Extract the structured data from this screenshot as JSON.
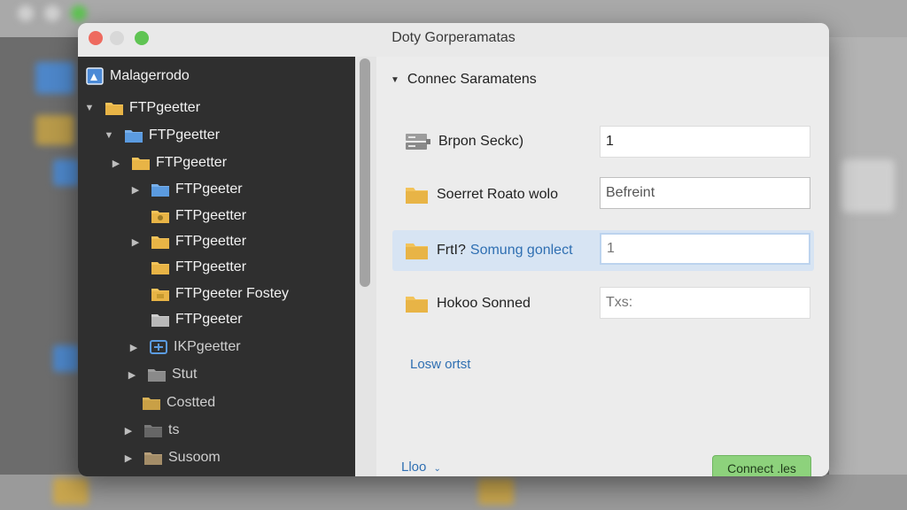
{
  "window": {
    "title": "Doty Gorperamatas"
  },
  "sidebar": {
    "root_label": "Malagerrodo",
    "items": [
      {
        "label": "FTPgeetter",
        "disclosure": "open",
        "icon": "folder-yellow"
      },
      {
        "label": "FTPgeetter",
        "disclosure": "open",
        "icon": "folder-blue"
      },
      {
        "label": "FTPgeetter",
        "disclosure": "closed",
        "icon": "folder-yellow"
      },
      {
        "label": "FTPgeeter",
        "disclosure": "closed",
        "icon": "folder-blue"
      },
      {
        "label": "FTPgeetter",
        "disclosure": "none",
        "icon": "folder-yellow"
      },
      {
        "label": "FTPgeetter",
        "disclosure": "closed",
        "icon": "folder-yellow"
      },
      {
        "label": "FTPgeetter",
        "disclosure": "none",
        "icon": "folder-yellow"
      },
      {
        "label": "FTPgeeter Fostey",
        "disclosure": "none",
        "icon": "folder-yellow"
      },
      {
        "label": "FTPgeeter",
        "disclosure": "none",
        "icon": "folder-gray"
      },
      {
        "label": "IKPgeetter",
        "disclosure": "closed",
        "icon": "network-folder-icon"
      },
      {
        "label": "Stut",
        "disclosure": "closed",
        "icon": "folder-gray"
      },
      {
        "label": "Costted",
        "disclosure": "none",
        "icon": "folder-yellow"
      },
      {
        "label": "ts",
        "disclosure": "closed",
        "icon": "folder-gray"
      },
      {
        "label": "Susoom",
        "disclosure": "closed",
        "icon": "folder-tan"
      }
    ]
  },
  "pane": {
    "section_title": "Connec Saramatens",
    "rows": [
      {
        "label": "Brpon Seckc)",
        "value": "1",
        "placeholder": "",
        "icon": "server-icon"
      },
      {
        "label": "Soerret Roato wolo",
        "value": "Befreint",
        "placeholder": "",
        "icon": "folder-icon"
      },
      {
        "label_part1": "FrtI?",
        "label_part2": "Somung gonlect",
        "value": "",
        "placeholder": "1",
        "icon": "folder-icon"
      },
      {
        "label": "Hokoo Sonned",
        "value": "",
        "placeholder": "Txs:",
        "icon": "folder-icon"
      }
    ],
    "link_label": "Losw ortst",
    "footer_link": "Lloo",
    "connect_label": "Connect .les"
  },
  "colors": {
    "sidebar_bg": "#2f2f2f",
    "highlight_row": "#d7e4f3",
    "link": "#2f6fb2",
    "connect_button": "#8dd27c"
  }
}
